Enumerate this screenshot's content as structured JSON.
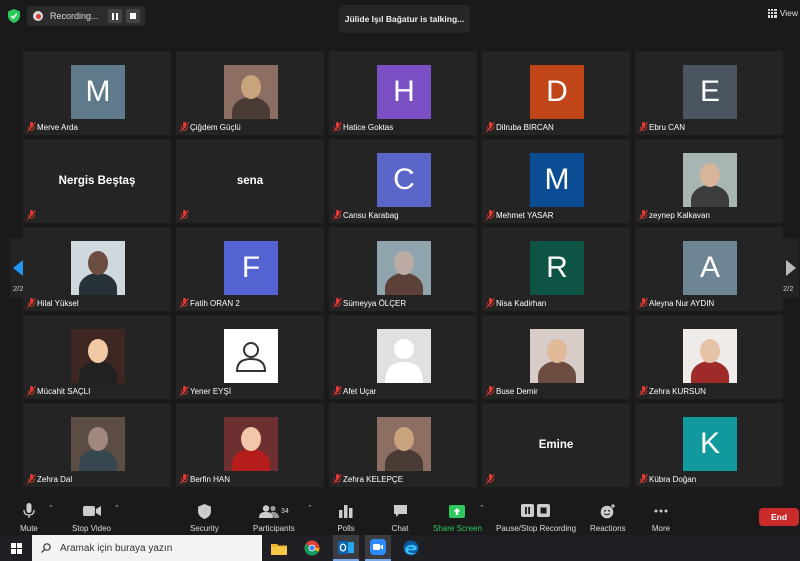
{
  "topbar": {
    "recording_label": "Recording...",
    "talking_text": "Jülide Işıl Bağatur is talking...",
    "view_label": "View"
  },
  "navigation": {
    "left_page": "2/2",
    "right_page": "2/2"
  },
  "participants": [
    {
      "name": "Merve Arda",
      "type": "letter",
      "letter": "M",
      "color": "#5f7a8a"
    },
    {
      "name": "Çiğdem Güçlü",
      "type": "photo"
    },
    {
      "name": "Hatice Goktas",
      "type": "letter",
      "letter": "H",
      "color": "#7b4fc4"
    },
    {
      "name": "Dilruba BIRCAN",
      "type": "letter",
      "letter": "D",
      "color": "#c0461a"
    },
    {
      "name": "Ebru CAN",
      "type": "letter",
      "letter": "E",
      "color": "#4a5560"
    },
    {
      "name": "",
      "type": "bigname",
      "big_name": "Nergis Beştaş"
    },
    {
      "name": "",
      "type": "bigname",
      "big_name": "sena"
    },
    {
      "name": "Cansu Karabag",
      "type": "letter",
      "letter": "C",
      "color": "#5a67c8"
    },
    {
      "name": "Mehmet YASAR",
      "type": "letter",
      "letter": "M",
      "color": "#0b4d94"
    },
    {
      "name": "zeynep Kalkavan",
      "type": "photo"
    },
    {
      "name": "Hilal Yüksel",
      "type": "photo"
    },
    {
      "name": "Fatih ORAN 2",
      "type": "letter",
      "letter": "F",
      "color": "#5563d2"
    },
    {
      "name": "Sümeyya ÖLÇER",
      "type": "photo"
    },
    {
      "name": "Nisa Kadirhan",
      "type": "letter",
      "letter": "R",
      "color": "#0e5444"
    },
    {
      "name": "Aleyna Nur AYDIN",
      "type": "letter",
      "letter": "A",
      "color": "#6e8594"
    },
    {
      "name": "Mücahit SAÇLI",
      "type": "photo"
    },
    {
      "name": "Yener EYŞİ",
      "type": "default"
    },
    {
      "name": "Afet Uçar",
      "type": "grayperson"
    },
    {
      "name": "Buse Demir",
      "type": "photo"
    },
    {
      "name": "Zehra KURSUN",
      "type": "photo"
    },
    {
      "name": "Zehra Dal",
      "type": "photo"
    },
    {
      "name": "Berfin HAN",
      "type": "photo"
    },
    {
      "name": "Zehra KELEPÇE",
      "type": "photo"
    },
    {
      "name": "",
      "type": "bigname",
      "big_name": "Emine"
    },
    {
      "name": "Kübra Doğan",
      "type": "letter",
      "letter": "K",
      "color": "#12999d"
    }
  ],
  "toolbar": {
    "mute": "Mute",
    "stop_video": "Stop Video",
    "security": "Security",
    "participants": "Participants",
    "participant_count": "34",
    "polls": "Polls",
    "chat": "Chat",
    "share_screen": "Share Screen",
    "pause_stop_recording": "Pause/Stop Recording",
    "reactions": "Reactions",
    "more": "More",
    "end": "End"
  },
  "taskbar": {
    "search_placeholder": "Aramak için buraya yazın",
    "apps": [
      "file-explorer-icon",
      "chrome-icon",
      "outlook-icon",
      "zoom-icon",
      "edge-icon"
    ]
  },
  "colors": {
    "share_green": "#2ec95c",
    "end_red": "#c92a2a",
    "nav_blue": "#2196f3"
  }
}
